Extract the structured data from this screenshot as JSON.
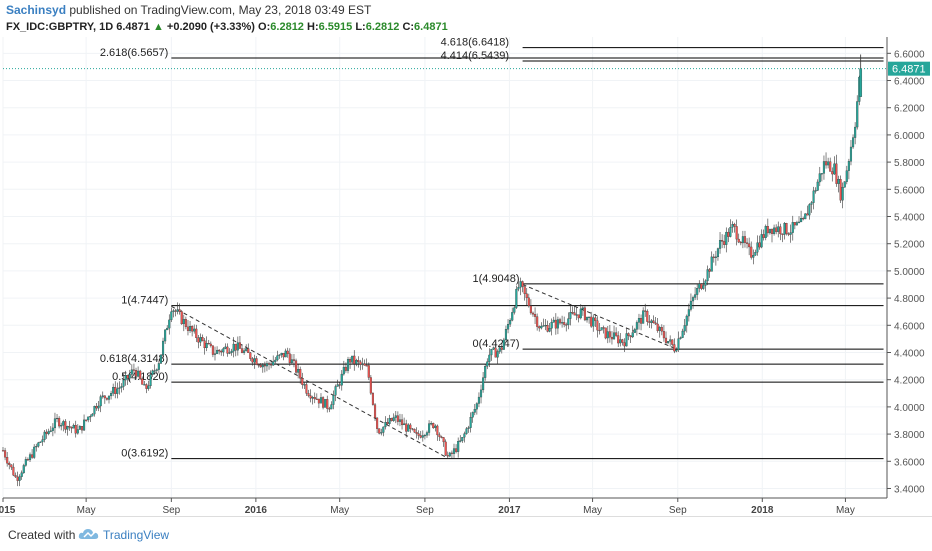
{
  "header": {
    "author": "Sachinsyd",
    "published": "published on TradingView.com, May 23, 2018 03:49 EST",
    "symbol": "FX_IDC:GBPTRY, 1D",
    "last": "6.4871",
    "change": "+0.2090 (+3.33%)",
    "o_label": "O:",
    "o": "6.2812",
    "h_label": "H:",
    "h": "6.5915",
    "l_label": "L:",
    "l": "6.2812",
    "c_label": "C:",
    "c": "6.4871"
  },
  "footer": {
    "created": "Created with",
    "brand": "TradingView",
    "logo_icon": "tradingview-cloud-icon"
  },
  "colors": {
    "up": "#26a69a",
    "down": "#ef5350",
    "line": "#000000",
    "axis": "#555555",
    "last_price_bg": "#26a69a",
    "author": "#3a7fc1",
    "ohlc_value": "#2b8a2b"
  },
  "chart_data": {
    "type": "candlestick",
    "title": "",
    "xlabel": "",
    "ylabel": "",
    "x_range": [
      "2015-01-01",
      "2018-06-30"
    ],
    "ylim": [
      3.33,
      6.72
    ],
    "x_ticks": [
      {
        "label": "015",
        "date": "2015-01-01"
      },
      {
        "label": "May",
        "date": "2015-05-01"
      },
      {
        "label": "Sep",
        "date": "2015-09-01"
      },
      {
        "label": "2016",
        "date": "2016-01-01"
      },
      {
        "label": "May",
        "date": "2016-05-01"
      },
      {
        "label": "Sep",
        "date": "2016-09-01"
      },
      {
        "label": "2017",
        "date": "2017-01-01"
      },
      {
        "label": "May",
        "date": "2017-05-01"
      },
      {
        "label": "Sep",
        "date": "2017-09-01"
      },
      {
        "label": "2018",
        "date": "2018-01-01"
      },
      {
        "label": "May",
        "date": "2018-05-01"
      }
    ],
    "y_ticks": [
      "3.4000",
      "3.6000",
      "3.8000",
      "4.0000",
      "4.2000",
      "4.4000",
      "4.6000",
      "4.8000",
      "5.0000",
      "5.2000",
      "5.4000",
      "5.6000",
      "5.8000",
      "6.0000",
      "6.2000",
      "6.4000",
      "6.6000"
    ],
    "last_price": {
      "value": 6.4871,
      "label": "6.4871"
    },
    "price_path": [
      {
        "date": "2015-01-01",
        "value": 3.68
      },
      {
        "date": "2015-01-20",
        "value": 3.47
      },
      {
        "date": "2015-02-20",
        "value": 3.72
      },
      {
        "date": "2015-03-20",
        "value": 3.9
      },
      {
        "date": "2015-04-20",
        "value": 3.82
      },
      {
        "date": "2015-05-20",
        "value": 4.05
      },
      {
        "date": "2015-06-20",
        "value": 4.15
      },
      {
        "date": "2015-07-10",
        "value": 4.28
      },
      {
        "date": "2015-07-25",
        "value": 4.12
      },
      {
        "date": "2015-08-15",
        "value": 4.35
      },
      {
        "date": "2015-09-01",
        "value": 4.74
      },
      {
        "date": "2015-10-01",
        "value": 4.55
      },
      {
        "date": "2015-11-01",
        "value": 4.4
      },
      {
        "date": "2015-12-01",
        "value": 4.45
      },
      {
        "date": "2016-01-15",
        "value": 4.3
      },
      {
        "date": "2016-02-15",
        "value": 4.4
      },
      {
        "date": "2016-03-15",
        "value": 4.12
      },
      {
        "date": "2016-04-15",
        "value": 4.0
      },
      {
        "date": "2016-05-15",
        "value": 4.35
      },
      {
        "date": "2016-06-10",
        "value": 4.28
      },
      {
        "date": "2016-06-25",
        "value": 3.82
      },
      {
        "date": "2016-07-20",
        "value": 3.92
      },
      {
        "date": "2016-08-20",
        "value": 3.78
      },
      {
        "date": "2016-09-15",
        "value": 3.88
      },
      {
        "date": "2016-10-05",
        "value": 3.62
      },
      {
        "date": "2016-10-25",
        "value": 3.76
      },
      {
        "date": "2016-11-15",
        "value": 4.02
      },
      {
        "date": "2016-12-01",
        "value": 4.38
      },
      {
        "date": "2016-12-20",
        "value": 4.42
      },
      {
        "date": "2017-01-15",
        "value": 4.9
      },
      {
        "date": "2017-02-15",
        "value": 4.58
      },
      {
        "date": "2017-03-15",
        "value": 4.62
      },
      {
        "date": "2017-04-15",
        "value": 4.7
      },
      {
        "date": "2017-05-15",
        "value": 4.55
      },
      {
        "date": "2017-06-15",
        "value": 4.48
      },
      {
        "date": "2017-07-15",
        "value": 4.68
      },
      {
        "date": "2017-08-15",
        "value": 4.5
      },
      {
        "date": "2017-08-28",
        "value": 4.43
      },
      {
        "date": "2017-09-25",
        "value": 4.82
      },
      {
        "date": "2017-10-10",
        "value": 4.95
      },
      {
        "date": "2017-11-01",
        "value": 5.2
      },
      {
        "date": "2017-11-20",
        "value": 5.32
      },
      {
        "date": "2017-12-15",
        "value": 5.12
      },
      {
        "date": "2018-01-10",
        "value": 5.32
      },
      {
        "date": "2018-02-10",
        "value": 5.3
      },
      {
        "date": "2018-03-01",
        "value": 5.35
      },
      {
        "date": "2018-04-01",
        "value": 5.8
      },
      {
        "date": "2018-04-15",
        "value": 5.75
      },
      {
        "date": "2018-04-25",
        "value": 5.55
      },
      {
        "date": "2018-05-05",
        "value": 5.8
      },
      {
        "date": "2018-05-15",
        "value": 6.1
      },
      {
        "date": "2018-05-23",
        "value": 6.4871
      }
    ],
    "fib_sets": [
      {
        "start": "2015-09-01",
        "end": "2018-06-25",
        "levels": [
          {
            "label": "2.618(6.5657)",
            "value": 6.5657
          },
          {
            "label": "1(4.7447)",
            "value": 4.7447
          },
          {
            "label": "0.618(4.3148)",
            "value": 4.3148
          },
          {
            "label": "0.5(4.1820)",
            "value": 4.182
          },
          {
            "label": "0(3.6192)",
            "value": 3.6192
          }
        ]
      },
      {
        "start": "2017-01-20",
        "end": "2018-06-25",
        "levels": [
          {
            "label": "4.618(6.6418)",
            "value": 6.6418
          },
          {
            "label": "4.414(6.5439)",
            "value": 6.5439
          },
          {
            "label": "1(4.9048)",
            "value": 4.9048
          },
          {
            "label": "0(4.4247)",
            "value": 4.4247
          }
        ]
      }
    ],
    "trend_lines": [
      {
        "from": {
          "date": "2015-09-01",
          "value": 4.74
        },
        "to": {
          "date": "2016-10-05",
          "value": 3.62
        }
      },
      {
        "from": {
          "date": "2017-01-20",
          "value": 4.9
        },
        "to": {
          "date": "2017-08-28",
          "value": 4.43
        }
      }
    ]
  }
}
